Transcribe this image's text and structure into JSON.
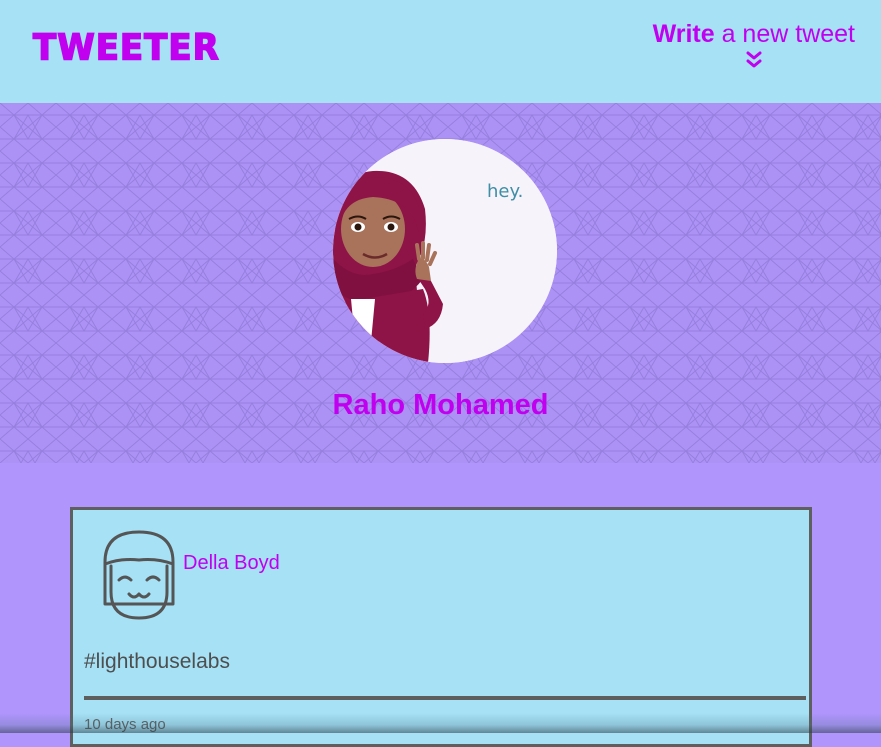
{
  "nav": {
    "brand": "TWEETER",
    "compose_strong": "Write",
    "compose_rest": " a new tweet"
  },
  "profile": {
    "name": "Raho Mohamed",
    "avatar_caption": "hey."
  },
  "tweets": [
    {
      "author": "Della Boyd",
      "content": "#lighthouselabs",
      "timestamp": "10 days ago"
    }
  ],
  "colors": {
    "accent": "#c100f0",
    "nav_bg": "#a6e1f5",
    "page_bg": "#b095fd",
    "tweet_border": "#5f5f5f"
  }
}
